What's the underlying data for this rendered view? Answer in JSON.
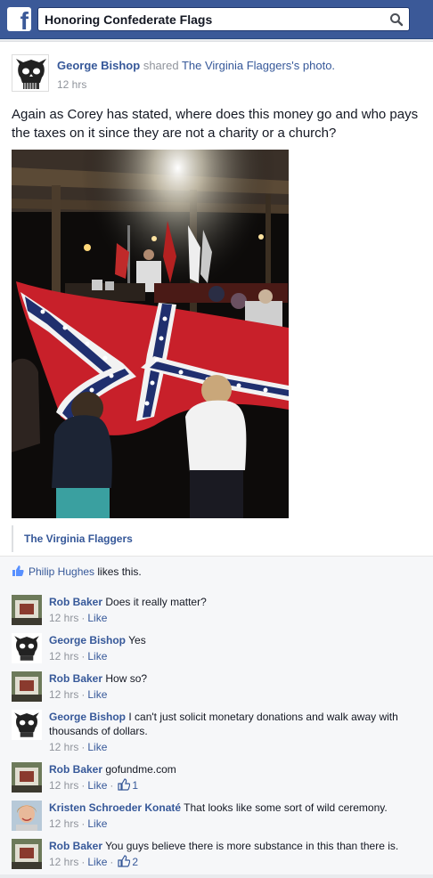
{
  "search": {
    "query": "Honoring Confederate Flags"
  },
  "post": {
    "author": "George Bishop",
    "shared_word": "shared",
    "page_name": "The Virginia Flaggers",
    "possessive": "'s",
    "object": "photo.",
    "time": "12 hrs",
    "text": "Again as Corey has stated, where does this money go and who pays the taxes on it since they are not a charity or a church?",
    "attribution": "The Virginia Flaggers"
  },
  "likes": {
    "name": "Philip Hughes",
    "text": " likes this."
  },
  "comments": [
    {
      "author": "Rob Baker",
      "text": "Does it really matter?",
      "time": "12 hrs",
      "like_label": "Like",
      "likes": ""
    },
    {
      "author": "George Bishop",
      "text": "Yes",
      "time": "12 hrs",
      "like_label": "Like",
      "likes": ""
    },
    {
      "author": "Rob Baker",
      "text": "How so?",
      "time": "12 hrs",
      "like_label": "Like",
      "likes": ""
    },
    {
      "author": "George Bishop",
      "text": "I can't just solicit monetary donations and walk away with thousands of dollars.",
      "time": "12 hrs",
      "like_label": "Like",
      "likes": ""
    },
    {
      "author": "Rob Baker",
      "text": "gofundme.com",
      "time": "12 hrs",
      "like_label": "Like",
      "likes": "1"
    },
    {
      "author": "Kristen Schroeder Konaté",
      "text": "That looks like some sort of wild ceremony.",
      "time": "12 hrs",
      "like_label": "Like",
      "likes": ""
    },
    {
      "author": "Rob Baker",
      "text": "You guys believe there is more substance in this than there is.",
      "time": "12 hrs",
      "like_label": "Like",
      "likes": "2"
    }
  ],
  "colors": {
    "brand": "#3b5998",
    "link": "#365899",
    "muted": "#90949c"
  }
}
